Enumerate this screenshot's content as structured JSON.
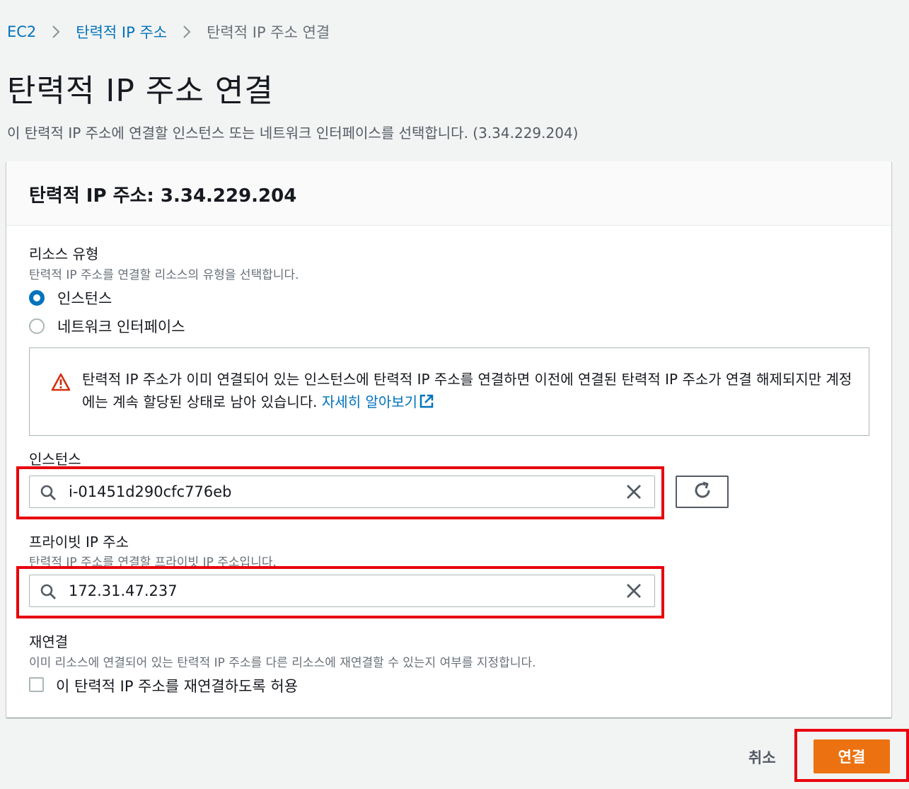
{
  "breadcrumb": {
    "items": [
      {
        "label": "EC2"
      },
      {
        "label": "탄력적 IP 주소"
      },
      {
        "label": "탄력적 IP 주소 연결"
      }
    ]
  },
  "page": {
    "title": "탄력적 IP 주소 연결",
    "description": "이 탄력적 IP 주소에 연결할 인스턴스 또는 네트워크 인터페이스를 선택합니다. (3.34.229.204)"
  },
  "panel": {
    "title": "탄력적 IP 주소: 3.34.229.204",
    "resource_type": {
      "label": "리소스 유형",
      "description": "탄력적 IP 주소를 연결할 리소스의 유형을 선택합니다.",
      "options": [
        {
          "label": "인스턴스",
          "selected": true
        },
        {
          "label": "네트워크 인터페이스",
          "selected": false
        }
      ]
    },
    "alert": {
      "icon": "warning-icon",
      "text": "탄력적 IP 주소가 이미 연결되어 있는 인스턴스에 탄력적 IP 주소를 연결하면 이전에 연결된 탄력적 IP 주소가 연결 해제되지만 계정에는 계속 할당된 상태로 남아 있습니다.",
      "link": "자세히 알아보기"
    },
    "instance": {
      "label": "인스턴스",
      "value": "i-01451d290cfc776eb"
    },
    "private_ip": {
      "label": "프라이빗 IP 주소",
      "description": "탄력적 IP 주소를 연결할 프라이빗 IP 주소입니다.",
      "value": "172.31.47.237"
    },
    "reassociation": {
      "label": "재연결",
      "description": "이미 리소스에 연결되어 있는 탄력적 IP 주소를 다른 리소스에 재연결할 수 있는지 여부를 지정합니다.",
      "checkbox_label": "이 탄력적 IP 주소를 재연결하도록 허용",
      "checked": false
    }
  },
  "footer": {
    "cancel_label": "취소",
    "submit_label": "연결"
  },
  "colors": {
    "accent": "#0073bb",
    "primary_button": "#ec7211",
    "highlight_box": "#e8000b",
    "warning": "#d13212"
  }
}
